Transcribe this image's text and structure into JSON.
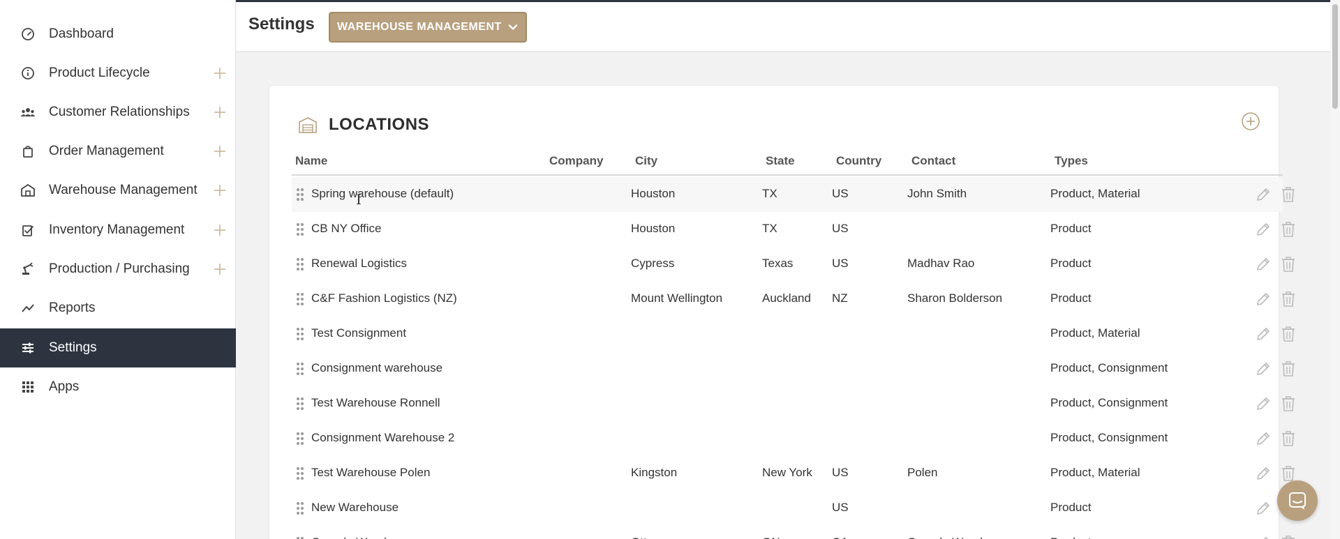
{
  "sidebar": {
    "items": [
      {
        "label": "Dashboard",
        "icon": "gauge-icon",
        "expandable": false,
        "active": false
      },
      {
        "label": "Product Lifecycle",
        "icon": "info-icon",
        "expandable": true,
        "active": false
      },
      {
        "label": "Customer Relationships",
        "icon": "people-icon",
        "expandable": true,
        "active": false
      },
      {
        "label": "Order Management",
        "icon": "bag-icon",
        "expandable": true,
        "active": false
      },
      {
        "label": "Warehouse Management",
        "icon": "warehouse-icon",
        "expandable": true,
        "active": false
      },
      {
        "label": "Inventory Management",
        "icon": "clipboard-check-icon",
        "expandable": true,
        "active": false
      },
      {
        "label": "Production / Purchasing",
        "icon": "robot-arm-icon",
        "expandable": true,
        "active": false
      },
      {
        "label": "Reports",
        "icon": "trend-line-icon",
        "expandable": false,
        "active": false
      },
      {
        "label": "Settings",
        "icon": "sliders-icon",
        "expandable": false,
        "active": true
      },
      {
        "label": "Apps",
        "icon": "grid-icon",
        "expandable": false,
        "active": false
      }
    ]
  },
  "header": {
    "title": "Settings",
    "module_button": "WAREHOUSE MANAGEMENT"
  },
  "locations": {
    "title": "LOCATIONS",
    "columns": {
      "name": "Name",
      "company": "Company",
      "city": "City",
      "state": "State",
      "country": "Country",
      "contact": "Contact",
      "types": "Types"
    },
    "rows": [
      {
        "name": "Spring warehouse (default)",
        "company": "",
        "city": "Houston",
        "state": "TX",
        "country": "US",
        "contact": "John Smith",
        "types": "Product, Material"
      },
      {
        "name": "CB NY Office",
        "company": "",
        "city": "Houston",
        "state": "TX",
        "country": "US",
        "contact": "",
        "types": "Product"
      },
      {
        "name": "Renewal Logistics",
        "company": "",
        "city": "Cypress",
        "state": "Texas",
        "country": "US",
        "contact": "Madhav Rao",
        "types": "Product"
      },
      {
        "name": "C&F Fashion Logistics (NZ)",
        "company": "",
        "city": "Mount Wellington",
        "state": "Auckland",
        "country": "NZ",
        "contact": "Sharon Bolderson",
        "types": "Product"
      },
      {
        "name": "Test Consignment",
        "company": "",
        "city": "",
        "state": "",
        "country": "",
        "contact": "",
        "types": "Product, Material"
      },
      {
        "name": "Consignment warehouse",
        "company": "",
        "city": "",
        "state": "",
        "country": "",
        "contact": "",
        "types": "Product, Consignment"
      },
      {
        "name": "Test Warehouse Ronnell",
        "company": "",
        "city": "",
        "state": "",
        "country": "",
        "contact": "",
        "types": "Product, Consignment"
      },
      {
        "name": "Consignment Warehouse 2",
        "company": "",
        "city": "",
        "state": "",
        "country": "",
        "contact": "",
        "types": "Product, Consignment"
      },
      {
        "name": "Test Warehouse Polen",
        "company": "",
        "city": "Kingston",
        "state": "New York",
        "country": "US",
        "contact": "Polen",
        "types": "Product, Material"
      },
      {
        "name": "New Warehouse",
        "company": "",
        "city": "",
        "state": "",
        "country": "US",
        "contact": "",
        "types": "Product"
      },
      {
        "name": "Canada Warehouse",
        "company": "",
        "city": "Ottawa",
        "state": "ON",
        "country": "CA",
        "contact": "Canada Warehouse",
        "types": "Product"
      }
    ]
  },
  "colors": {
    "accent": "#b8a07f",
    "sidebar_active": "#2d3440"
  }
}
